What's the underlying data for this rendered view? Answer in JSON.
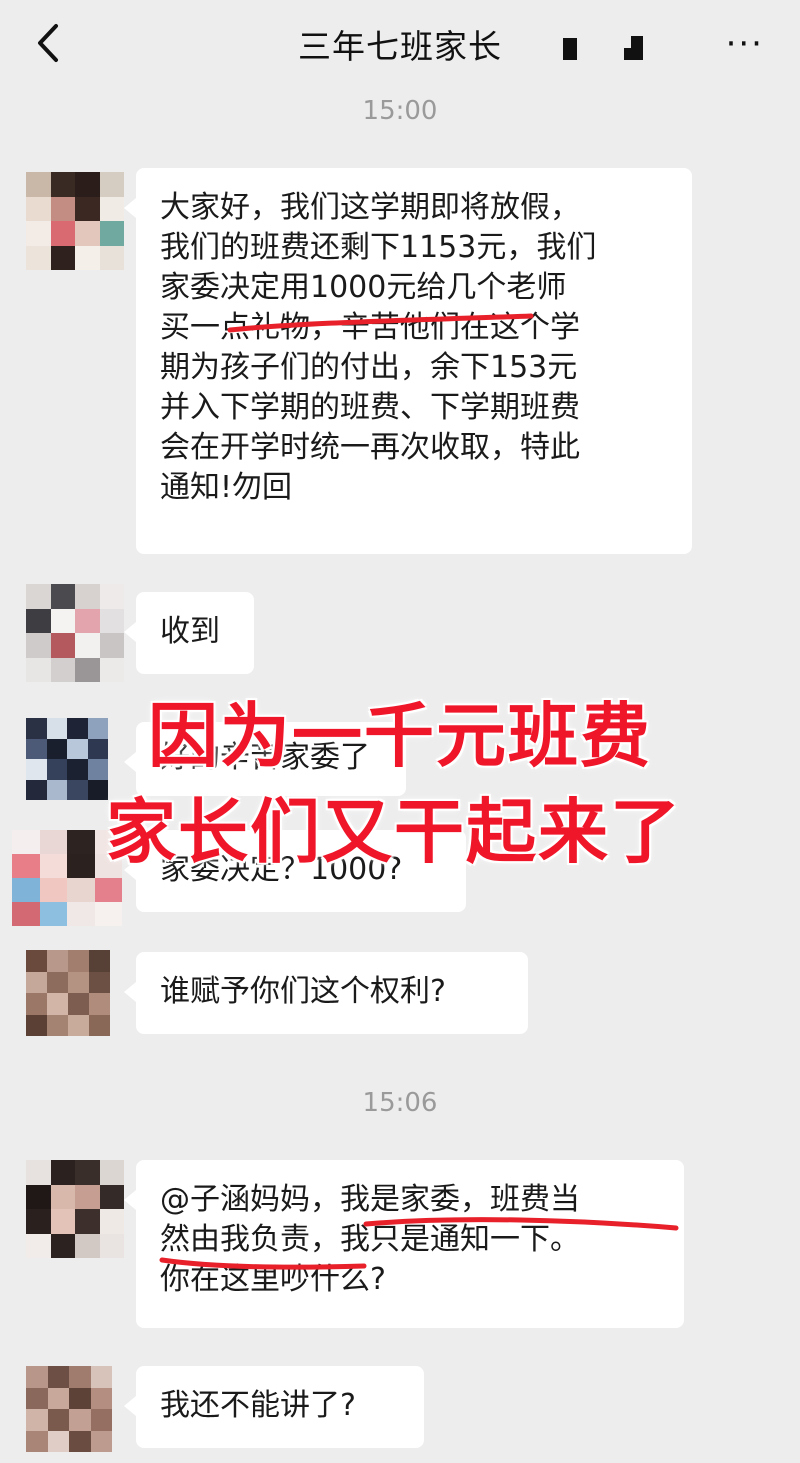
{
  "header": {
    "title": "三年七班家长",
    "back_icon": "chevron-left-icon",
    "more_label": "···"
  },
  "timestamps": [
    "15:00",
    "15:06"
  ],
  "messages": [
    {
      "lines": [
        "大家好，我们这学期即将放假，",
        "我们的班费还剩下1153元，我们",
        "家委决定用1000元给几个老师",
        "买一点礼物，辛苦他们在这个学",
        "期为孩子们的付出，余下153元",
        "并入下学期的班费、下学期班费",
        "会在开学时统一再次收取，特此",
        "通知!勿回"
      ]
    },
    {
      "lines": [
        "收到"
      ]
    },
    {
      "lines": [
        "好的辛苦家委了"
      ]
    },
    {
      "lines": [
        "家委决定？1000?"
      ]
    },
    {
      "lines": [
        "谁赋予你们这个权利?"
      ]
    },
    {
      "lines": [
        "@子涵妈妈，我是家委，班费当",
        "然由我负责，我只是通知一下。",
        "你在这里吵什么?"
      ]
    },
    {
      "lines": [
        "我还不能讲了?"
      ]
    }
  ],
  "overlay": {
    "line1": "因为一千元班费",
    "line2": "家长们又干起来了",
    "color": "#f0162a"
  },
  "colors": {
    "background": "#ededed",
    "bubble": "#ffffff",
    "underline": "#e8202a"
  }
}
